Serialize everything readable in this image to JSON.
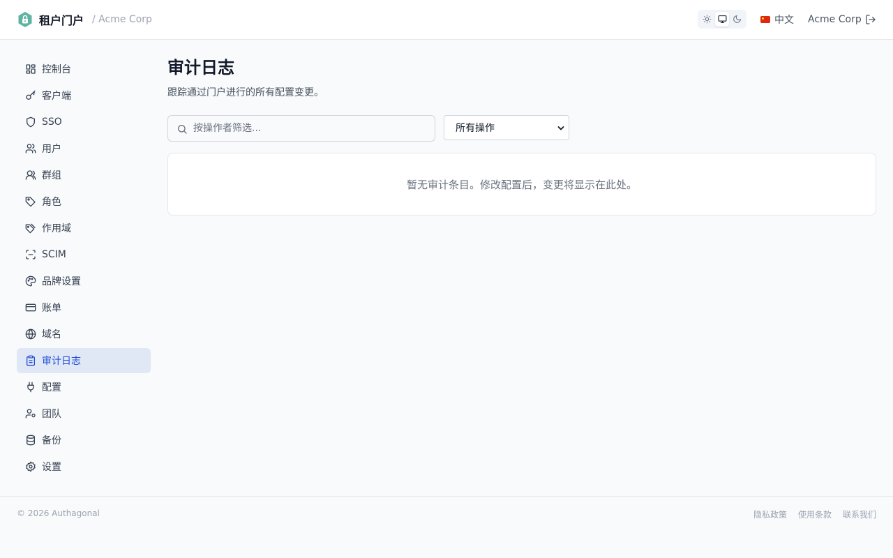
{
  "header": {
    "brand_name": "租户门户",
    "tenant_crumb": "/ Acme Corp",
    "theme_options": [
      "sun-icon",
      "monitor-icon",
      "moon-icon"
    ],
    "theme_selected": "monitor-icon",
    "language_label": "中文",
    "account_name": "Acme Corp"
  },
  "sidebar": {
    "items": [
      {
        "label": "控制台",
        "icon": "dashboard-icon"
      },
      {
        "label": "客户端",
        "icon": "key-icon"
      },
      {
        "label": "SSO",
        "icon": "shield-icon"
      },
      {
        "label": "用户",
        "icon": "users-icon"
      },
      {
        "label": "群组",
        "icon": "group-icon"
      },
      {
        "label": "角色",
        "icon": "tag-icon"
      },
      {
        "label": "作用域",
        "icon": "tags-icon"
      },
      {
        "label": "SCIM",
        "icon": "scan-icon"
      },
      {
        "label": "品牌设置",
        "icon": "palette-icon"
      },
      {
        "label": "账单",
        "icon": "credit-card-icon"
      },
      {
        "label": "域名",
        "icon": "globe-icon"
      },
      {
        "label": "审计日志",
        "icon": "clipboard-icon",
        "active": true
      },
      {
        "label": "配置",
        "icon": "plug-icon"
      },
      {
        "label": "团队",
        "icon": "user-cog-icon"
      },
      {
        "label": "备份",
        "icon": "database-icon"
      },
      {
        "label": "设置",
        "icon": "gear-icon"
      }
    ]
  },
  "main": {
    "title": "审计日志",
    "subtitle": "跟踪通过门户进行的所有配置变更。",
    "search_placeholder": "按操作者筛选...",
    "search_value": "",
    "action_filter_selected": "所有操作",
    "empty_message": "暂无审计条目。修改配置后，变更将显示在此处。"
  },
  "footer": {
    "copyright": "© 2026 Authagonal",
    "links": [
      "隐私政策",
      "使用条款",
      "联系我们"
    ]
  },
  "colors": {
    "accent": "#1d4ed8",
    "active_bg": "#e0e7f5",
    "logo": "#5fb3a3",
    "page_bg": "#f8fafc"
  }
}
